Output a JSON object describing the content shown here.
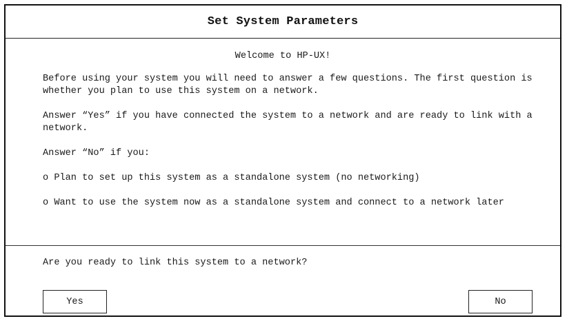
{
  "window": {
    "title": "Set System Parameters"
  },
  "content": {
    "welcome": "Welcome to HP-UX!",
    "intro": "Before using your system you will need to answer a few questions. The first question is whether you plan to use this system on a network.",
    "yes_explanation": "Answer “Yes” if you have connected the system to a network and are ready to link with a network.",
    "no_intro": "Answer “No” if you:",
    "no_options": [
      "o Plan to set up this system as a standalone system (no networking)",
      "o Want to use the system now as a standalone system and connect to a network later"
    ]
  },
  "prompt": {
    "question": "Are you ready to link this system to a network?"
  },
  "buttons": {
    "yes_label": "Yes",
    "no_label": "No"
  }
}
